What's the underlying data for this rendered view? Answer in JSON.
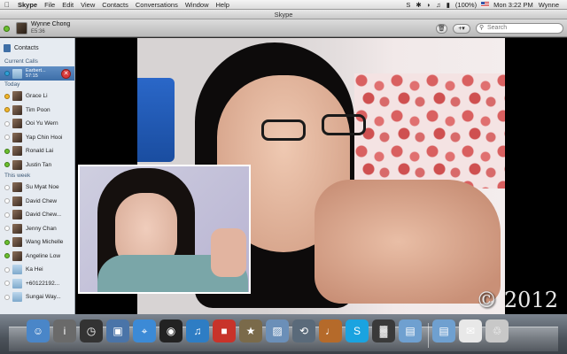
{
  "menubar": {
    "apple": "",
    "items": [
      "Skype",
      "File",
      "Edit",
      "View",
      "Contacts",
      "Conversations",
      "Window",
      "Help"
    ],
    "battery": "(100%)",
    "clock": "Mon 3:22 PM",
    "user": "Wynne"
  },
  "window": {
    "title": "Skype"
  },
  "profile": {
    "name": "Wynne Chong",
    "mood": "E5:36",
    "status": "online"
  },
  "search": {
    "placeholder": "Search"
  },
  "toolbar": {
    "trash_label": "🗑",
    "add_label": "+▾"
  },
  "sidebar": {
    "contacts_label": "Contacts",
    "current_calls_label": "Current Calls",
    "active_call": {
      "name": "Earbert...",
      "duration": "57:15"
    },
    "today_label": "Today",
    "today": [
      {
        "name": "Grace Li",
        "status": "away"
      },
      {
        "name": "Tim Poon",
        "status": "away"
      },
      {
        "name": "Ooi Yu Wern",
        "status": "offline"
      },
      {
        "name": "Yap Chin Hooi",
        "status": "offline"
      },
      {
        "name": "Ronald Lai",
        "status": "online"
      },
      {
        "name": "Justin Tan",
        "status": "online"
      }
    ],
    "week_label": "This week",
    "this_week": [
      {
        "name": "Su Myat Noe",
        "status": "offline"
      },
      {
        "name": "David Chew",
        "status": "offline"
      },
      {
        "name": "David Chew...",
        "status": "offline"
      },
      {
        "name": "Jenny Chan",
        "status": "offline"
      },
      {
        "name": "Wang Michelle",
        "status": "online"
      },
      {
        "name": "Angeline Low",
        "status": "online"
      },
      {
        "name": "Ka Hei",
        "status": "offline"
      },
      {
        "name": "+60122192...",
        "status": "offline"
      },
      {
        "name": "Sungai Way...",
        "status": "offline"
      }
    ]
  },
  "watermark": "© 2012",
  "dock": {
    "icons": [
      "finder-icon",
      "system-info-icon",
      "dashboard-icon",
      "preview-icon",
      "safari-icon",
      "facetime-icon",
      "itunes-icon",
      "photo-booth-icon",
      "imovie-icon",
      "iphoto-icon",
      "time-machine-icon",
      "garageband-icon",
      "skype-icon",
      "activity-monitor-icon",
      "applications-folder-icon",
      "documents-folder-icon",
      "downloads-stack-icon",
      "trash-icon"
    ],
    "colors": [
      "#4a86c8",
      "#6a6a6a",
      "#333333",
      "#4a74a8",
      "#3c8ad6",
      "#222222",
      "#2e7dc4",
      "#c8332a",
      "#7a6a4a",
      "#6b8fb8",
      "#5a6a7a",
      "#b56a2a",
      "#1aa3e0",
      "#3a3a3a",
      "#6fa0d0",
      "#6fa0d0",
      "#e8e8e8",
      "#c8c8c8"
    ]
  }
}
